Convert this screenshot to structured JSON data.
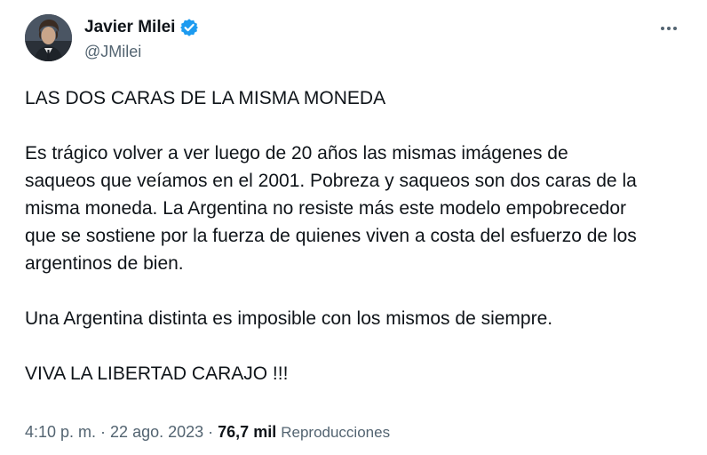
{
  "author": {
    "display_name": "Javier Milei",
    "handle": "@JMilei",
    "verified": true,
    "accent_color": "#1d9bf0"
  },
  "tweet": {
    "paragraphs": [
      "LAS DOS CARAS DE LA MISMA MONEDA",
      "Es trágico volver a ver luego de 20 años las mismas imágenes de\nsaqueos que veíamos en el 2001. Pobreza y saqueos son dos caras de la\nmisma moneda. La Argentina no resiste más este modelo empobrecedor\nque se sostiene por la fuerza de quienes viven a costa del esfuerzo de los\nargentinos de bien.",
      "Una Argentina distinta es imposible con los mismos de siempre.",
      "VIVA LA LIBERTAD CARAJO !!!"
    ]
  },
  "meta": {
    "time": "4:10 p. m.",
    "separator": " · ",
    "date": "22 ago. 2023",
    "views_count": "76,7 mil",
    "views_label": "Reproducciones"
  },
  "icons": {
    "verified": "verified-badge-icon",
    "more": "more-options-icon"
  }
}
